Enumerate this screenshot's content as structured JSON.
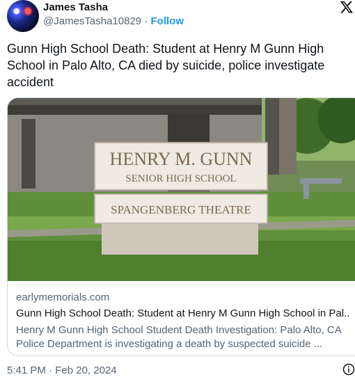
{
  "author": {
    "name": "James Tasha",
    "handle": "@JamesTasha10829",
    "separator": "·",
    "follow_label": "Follow"
  },
  "tweet": {
    "lines": [
      "Gunn High School Death: Student at Henry M Gunn High",
      "School in Palo Alto, CA died by suicide, police investigate",
      "accident"
    ]
  },
  "card": {
    "sign": {
      "line1": "HENRY M. GUNN",
      "line2": "SENIOR HIGH SCHOOL",
      "line3": "SPANGENBERG THEATRE"
    },
    "domain": "earlymemorials.com",
    "title": "Gunn High School Death: Student at Henry M Gunn High School in Pal...",
    "description_lines": [
      "Henry M Gunn High School Student Death Investigation: Palo Alto, CA",
      "Police Department is investigating a death by suspected suicide ..."
    ]
  },
  "footer": {
    "time": "5:41 PM",
    "separator": "·",
    "date": "Feb 20, 2024"
  },
  "icons": {
    "x_logo": "x-logo-icon",
    "info": "info-icon"
  },
  "colors": {
    "link": "#1d9bf0",
    "secondary_text": "#536471",
    "border": "#cfd9de"
  }
}
